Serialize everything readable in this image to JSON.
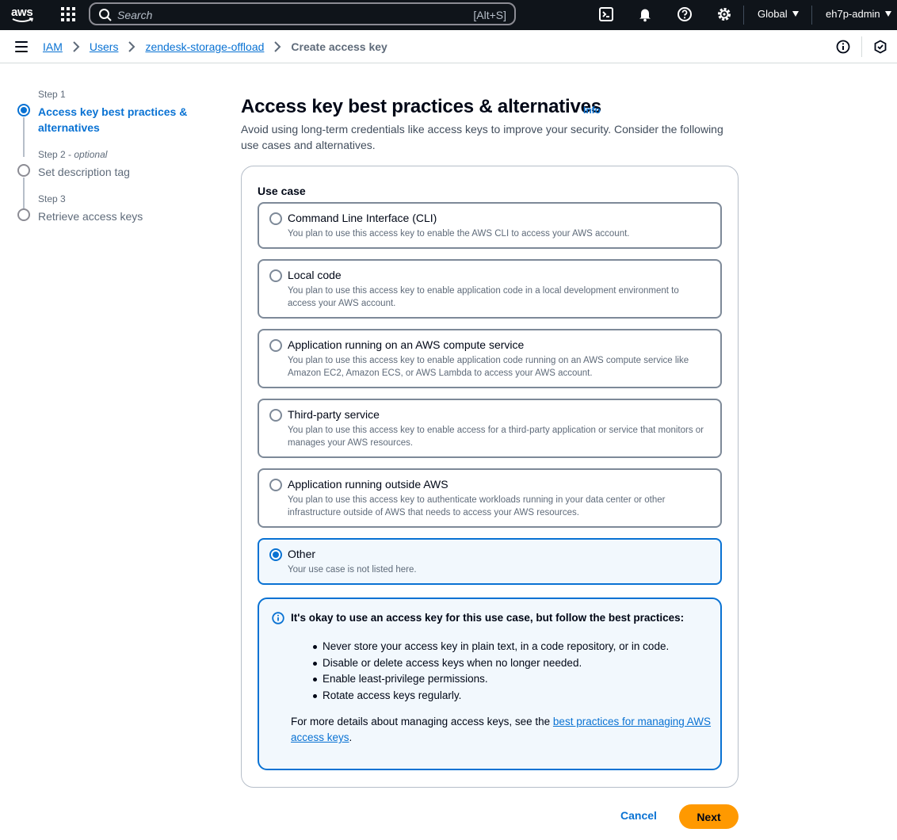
{
  "topnav": {
    "logo_text": "aws",
    "search_placeholder": "Search",
    "search_shortcut": "[Alt+S]",
    "region": "Global",
    "account": "eh7p-admin"
  },
  "breadcrumb": {
    "items": [
      "IAM",
      "Users",
      "zendesk-storage-offload"
    ],
    "current": "Create access key"
  },
  "steps": [
    {
      "label": "Step 1",
      "optional": "",
      "title": "Access key best practices & alternatives"
    },
    {
      "label": "Step 2",
      "optional": "optional",
      "title": "Set description tag"
    },
    {
      "label": "Step 3",
      "optional": "",
      "title": "Retrieve access keys"
    }
  ],
  "main": {
    "title": "Access key best practices & alternatives",
    "info": "Info",
    "description": "Avoid using long-term credentials like access keys to improve your security. Consider the following use cases and alternatives.",
    "use_case_label": "Use case",
    "use_cases": [
      {
        "title": "Command Line Interface (CLI)",
        "desc": "You plan to use this access key to enable the AWS CLI to access your AWS account."
      },
      {
        "title": "Local code",
        "desc": "You plan to use this access key to enable application code in a local development environment to access your AWS account."
      },
      {
        "title": "Application running on an AWS compute service",
        "desc": "You plan to use this access key to enable application code running on an AWS compute service like Amazon EC2, Amazon ECS, or AWS Lambda to access your AWS account."
      },
      {
        "title": "Third-party service",
        "desc": "You plan to use this access key to enable access for a third-party application or service that monitors or manages your AWS resources."
      },
      {
        "title": "Application running outside AWS",
        "desc": "You plan to use this access key to authenticate workloads running in your data center or other infrastructure outside of AWS that needs to access your AWS resources."
      },
      {
        "title": "Other",
        "desc": "Your use case is not listed here."
      }
    ],
    "selected_use_case": "Other",
    "alert": {
      "header": "It's okay to use an access key for this use case, but follow the best practices:",
      "items": [
        "Never store your access key in plain text, in a code repository, or in code.",
        "Disable or delete access keys when no longer needed.",
        "Enable least-privilege permissions.",
        "Rotate access keys regularly."
      ],
      "more_prefix": "For more details about managing access keys, see the ",
      "more_link": "best practices for managing AWS access keys",
      "more_suffix": "."
    }
  },
  "footer": {
    "cancel": "Cancel",
    "next": "Next"
  },
  "colors": {
    "nav_bg": "#0f141a",
    "link": "#0972d3",
    "primary_button": "#ff9900",
    "selected_bg": "#f2f8fd"
  }
}
